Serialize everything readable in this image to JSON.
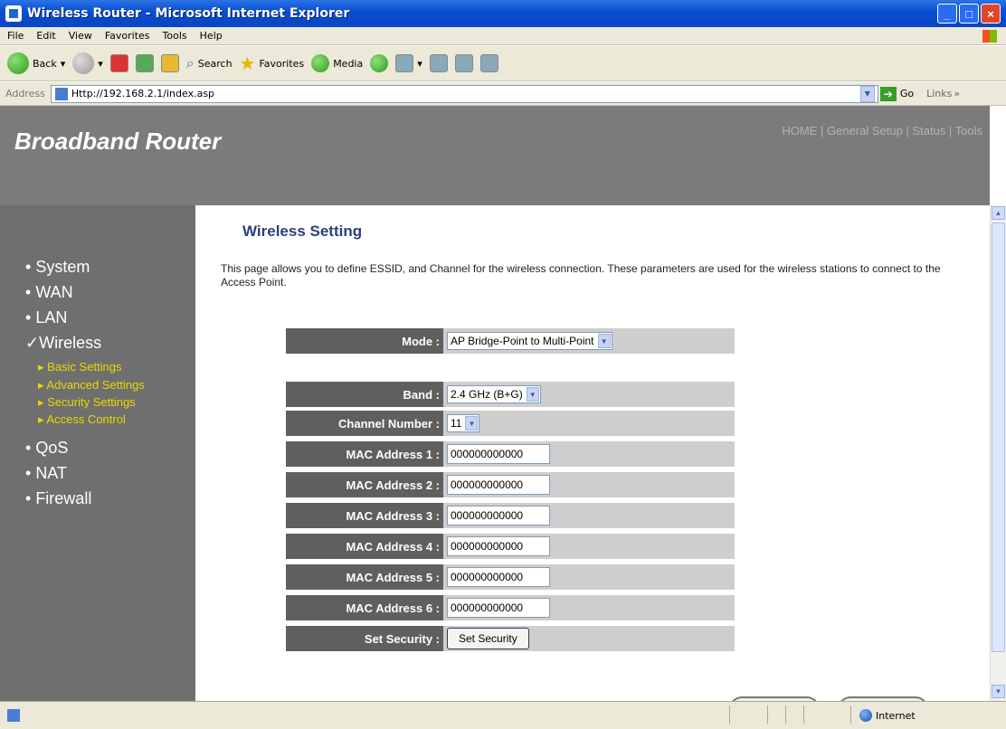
{
  "window": {
    "title": "Wireless Router - Microsoft Internet Explorer"
  },
  "menu": [
    "File",
    "Edit",
    "View",
    "Favorites",
    "Tools",
    "Help"
  ],
  "toolbar": {
    "back": "Back",
    "search": "Search",
    "favorites": "Favorites",
    "media": "Media"
  },
  "address": {
    "label": "Address",
    "url": "Http://192.168.2.1/index.asp",
    "go": "Go",
    "links": "Links"
  },
  "header": {
    "brand": "Broadband Router",
    "nav": "HOME | General Setup | Status | Tools"
  },
  "sidebar": {
    "items": [
      "System",
      "WAN",
      "LAN",
      "Wireless",
      "QoS",
      "NAT",
      "Firewall"
    ],
    "sub": [
      "Basic Settings",
      "Advanced Settings",
      "Security Settings",
      "Access Control"
    ]
  },
  "page": {
    "title": "Wireless Setting",
    "intro": "This page allows you to define ESSID, and Channel for the wireless connection. These parameters are used for the wireless stations to connect to the Access Point."
  },
  "form": {
    "mode": {
      "label": "Mode :",
      "value": "AP Bridge-Point to Multi-Point"
    },
    "band": {
      "label": "Band :",
      "value": "2.4 GHz (B+G)"
    },
    "channel": {
      "label": "Channel Number :",
      "value": "11"
    },
    "mac": [
      {
        "label": "MAC Address 1 :",
        "value": "000000000000"
      },
      {
        "label": "MAC Address 2 :",
        "value": "000000000000"
      },
      {
        "label": "MAC Address 3 :",
        "value": "000000000000"
      },
      {
        "label": "MAC Address 4 :",
        "value": "000000000000"
      },
      {
        "label": "MAC Address 5 :",
        "value": "000000000000"
      },
      {
        "label": "MAC Address 6 :",
        "value": "000000000000"
      }
    ],
    "security": {
      "label": "Set Security :",
      "button": "Set Security"
    }
  },
  "status": {
    "zone": "Internet"
  }
}
